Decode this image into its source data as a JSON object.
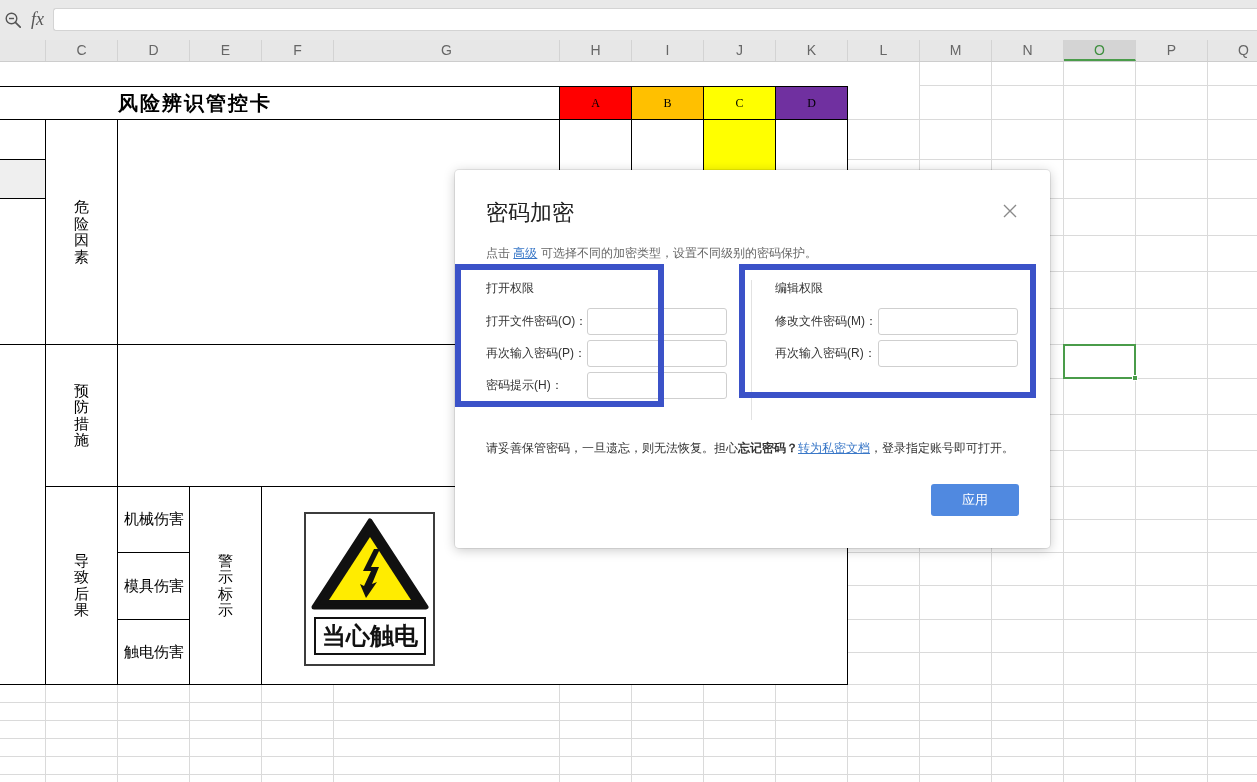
{
  "formula_bar": {
    "function_label": "fx"
  },
  "sheet": {
    "columns": [
      {
        "label": "C",
        "selected": false
      },
      {
        "label": "D",
        "selected": false
      },
      {
        "label": "E",
        "selected": false
      },
      {
        "label": "F",
        "selected": false
      },
      {
        "label": "G",
        "selected": false
      },
      {
        "label": "H",
        "selected": false
      },
      {
        "label": "I",
        "selected": false
      },
      {
        "label": "J",
        "selected": false
      },
      {
        "label": "K",
        "selected": false
      },
      {
        "label": "L",
        "selected": false
      },
      {
        "label": "M",
        "selected": false
      },
      {
        "label": "N",
        "selected": false
      },
      {
        "label": "O",
        "selected": true
      },
      {
        "label": "P",
        "selected": false
      },
      {
        "label": "Q",
        "selected": false
      }
    ]
  },
  "card": {
    "title": "风险辨识管控卡",
    "levels": [
      {
        "label": "A",
        "color": "#ff0000",
        "selected": false
      },
      {
        "label": "B",
        "color": "#ffc000",
        "selected": false
      },
      {
        "label": "C",
        "color": "#ffff00",
        "selected": true
      },
      {
        "label": "D",
        "color": "#7030a0",
        "selected": false
      }
    ],
    "sections": [
      {
        "label": "危险因素"
      },
      {
        "label": "预防措施"
      },
      {
        "label": "导致后果"
      }
    ],
    "consequences": [
      {
        "label": "机械伤害"
      },
      {
        "label": "模具伤害"
      },
      {
        "label": "触电伤害"
      }
    ],
    "sign_heading": "警示标示",
    "sign_text": "当心触电"
  },
  "dialog": {
    "title": "密码加密",
    "description": {
      "before": "点击 ",
      "link": "高级",
      "after": " 可选择不同的加密类型，设置不同级别的密码保护。"
    },
    "open_permission": {
      "heading": "打开权限",
      "fields": [
        {
          "label": "打开文件密码(O)："
        },
        {
          "label": "再次输入密码(P)："
        },
        {
          "label": "密码提示(H)："
        }
      ]
    },
    "edit_permission": {
      "heading": "编辑权限",
      "fields": [
        {
          "label": "修改文件密码(M)："
        },
        {
          "label": "再次输入密码(R)："
        }
      ]
    },
    "notice": {
      "before": "请妥善保管密码，一旦遗忘，则无法恢复。担心**忘记密码？**",
      "link": "转为私密文档",
      "after": "，登录指定账号即可打开。"
    },
    "apply_button": "应用"
  }
}
